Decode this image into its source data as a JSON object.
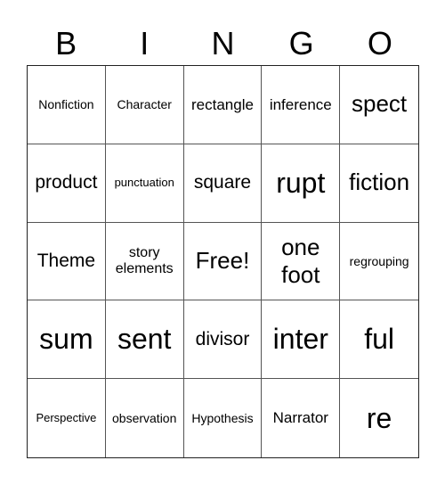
{
  "title_letters": [
    "B",
    "I",
    "N",
    "G",
    "O"
  ],
  "board": {
    "rows": [
      [
        "Nonfiction",
        "Character",
        "rectangle",
        "inference",
        "spect"
      ],
      [
        "product",
        "punctuation",
        "square",
        "rupt",
        "fiction"
      ],
      [
        "Theme",
        "story elements",
        "Free!",
        "one foot",
        "regrouping"
      ],
      [
        "sum",
        "sent",
        "divisor",
        "inter",
        "ful"
      ],
      [
        "Perspective",
        "observation",
        "Hypothesis",
        "Narrator",
        "re"
      ]
    ]
  }
}
